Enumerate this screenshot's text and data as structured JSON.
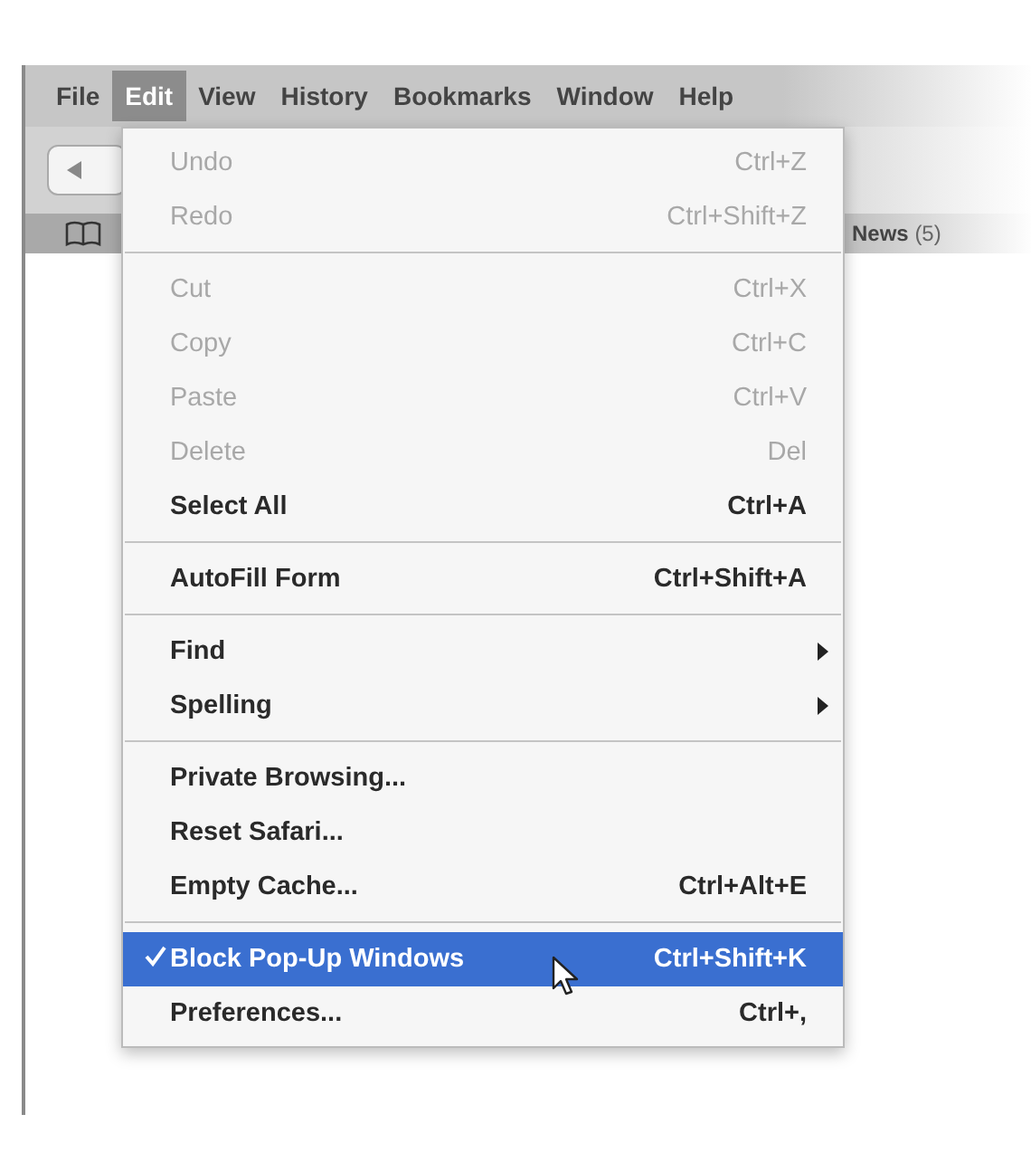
{
  "menubar": [
    {
      "label": "File",
      "selected": false
    },
    {
      "label": "Edit",
      "selected": true
    },
    {
      "label": "View",
      "selected": false
    },
    {
      "label": "History",
      "selected": false
    },
    {
      "label": "Bookmarks",
      "selected": false
    },
    {
      "label": "Window",
      "selected": false
    },
    {
      "label": "Help",
      "selected": false
    }
  ],
  "bookmarks_bar": {
    "items": [
      {
        "label": "News",
        "count": "(5)"
      }
    ]
  },
  "edit_menu": [
    {
      "kind": "item",
      "label": "Undo",
      "shortcut": "Ctrl+Z",
      "disabled": true,
      "checked": false,
      "selected": false
    },
    {
      "kind": "item",
      "label": "Redo",
      "shortcut": "Ctrl+Shift+Z",
      "disabled": true,
      "checked": false,
      "selected": false
    },
    {
      "kind": "separator"
    },
    {
      "kind": "item",
      "label": "Cut",
      "shortcut": "Ctrl+X",
      "disabled": true,
      "checked": false,
      "selected": false
    },
    {
      "kind": "item",
      "label": "Copy",
      "shortcut": "Ctrl+C",
      "disabled": true,
      "checked": false,
      "selected": false
    },
    {
      "kind": "item",
      "label": "Paste",
      "shortcut": "Ctrl+V",
      "disabled": true,
      "checked": false,
      "selected": false
    },
    {
      "kind": "item",
      "label": "Delete",
      "shortcut": "Del",
      "disabled": true,
      "checked": false,
      "selected": false
    },
    {
      "kind": "item",
      "label": "Select All",
      "shortcut": "Ctrl+A",
      "disabled": false,
      "checked": false,
      "selected": false
    },
    {
      "kind": "separator"
    },
    {
      "kind": "item",
      "label": "AutoFill Form",
      "shortcut": "Ctrl+Shift+A",
      "disabled": false,
      "checked": false,
      "selected": false
    },
    {
      "kind": "separator"
    },
    {
      "kind": "submenu",
      "label": "Find",
      "disabled": false,
      "selected": false
    },
    {
      "kind": "submenu",
      "label": "Spelling",
      "disabled": false,
      "selected": false
    },
    {
      "kind": "separator"
    },
    {
      "kind": "item",
      "label": "Private Browsing...",
      "disabled": false,
      "checked": false,
      "selected": false
    },
    {
      "kind": "item",
      "label": "Reset Safari...",
      "disabled": false,
      "checked": false,
      "selected": false
    },
    {
      "kind": "item",
      "label": "Empty Cache...",
      "shortcut": "Ctrl+Alt+E",
      "disabled": false,
      "checked": false,
      "selected": false
    },
    {
      "kind": "separator"
    },
    {
      "kind": "item",
      "label": "Block Pop-Up Windows",
      "shortcut": "Ctrl+Shift+K",
      "disabled": false,
      "checked": true,
      "selected": true
    },
    {
      "kind": "item",
      "label": "Preferences...",
      "shortcut": "Ctrl+,",
      "disabled": false,
      "checked": false,
      "selected": false
    }
  ]
}
